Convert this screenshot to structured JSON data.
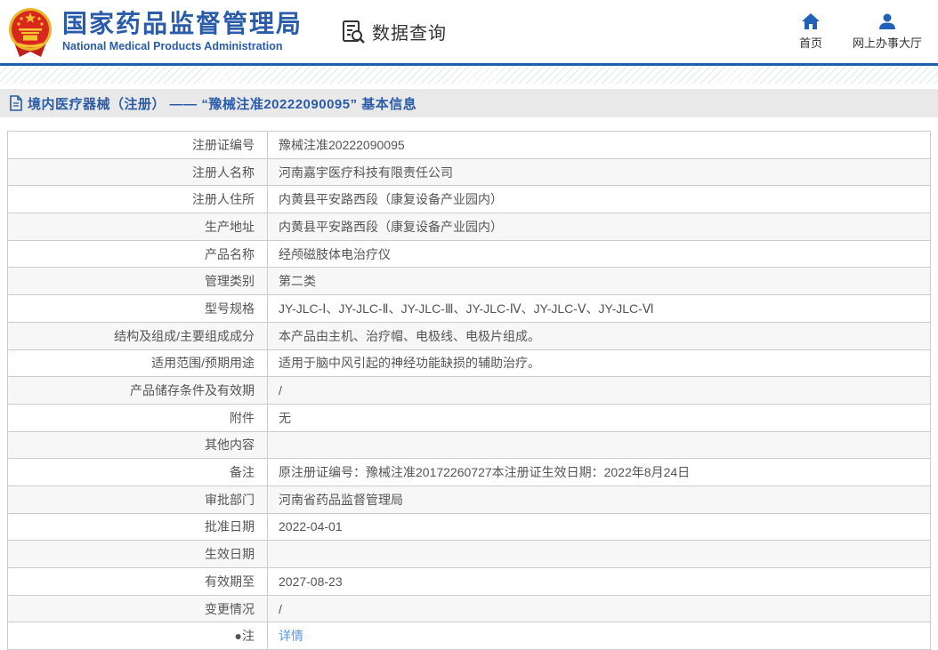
{
  "header": {
    "brand_title": "国家药品监督管理局",
    "brand_subtitle": "National Medical Products Administration",
    "data_query_label": "数据查询",
    "nav": {
      "home_label": "首页",
      "hall_label": "网上办事大厅"
    }
  },
  "title_bar": {
    "text": "境内医疗器械（注册） —— “豫械注准20222090095” 基本信息"
  },
  "table": {
    "rows": [
      {
        "label": "注册证编号",
        "value": "豫械注准20222090095"
      },
      {
        "label": "注册人名称",
        "value": "河南嘉宇医疗科技有限责任公司"
      },
      {
        "label": "注册人住所",
        "value": "内黄县平安路西段（康复设备产业园内）"
      },
      {
        "label": "生产地址",
        "value": "内黄县平安路西段（康复设备产业园内）"
      },
      {
        "label": "产品名称",
        "value": "经颅磁肢体电治疗仪"
      },
      {
        "label": "管理类别",
        "value": "第二类"
      },
      {
        "label": "型号规格",
        "value": "JY-JLC-Ⅰ、JY-JLC-Ⅱ、JY-JLC-Ⅲ、JY-JLC-Ⅳ、JY-JLC-Ⅴ、JY-JLC-Ⅵ"
      },
      {
        "label": "结构及组成/主要组成成分",
        "value": "本产品由主机、治疗帽、电极线、电极片组成。"
      },
      {
        "label": "适用范围/预期用途",
        "value": "适用于脑中风引起的神经功能缺损的辅助治疗。"
      },
      {
        "label": "产品储存条件及有效期",
        "value": "/"
      },
      {
        "label": "附件",
        "value": "无"
      },
      {
        "label": "其他内容",
        "value": ""
      },
      {
        "label": "备注",
        "value": "原注册证编号：豫械注准20172260727本注册证生效日期：2022年8月24日"
      },
      {
        "label": "审批部门",
        "value": "河南省药品监督管理局"
      },
      {
        "label": "批准日期",
        "value": "2022-04-01"
      },
      {
        "label": "生效日期",
        "value": ""
      },
      {
        "label": "有效期至",
        "value": "2027-08-23"
      },
      {
        "label": "变更情况",
        "value": "/"
      },
      {
        "label": "●注",
        "value": "详情",
        "link": true
      }
    ]
  },
  "colors": {
    "brand_blue": "#2a5caa",
    "nav_icon_blue": "#1f62b8",
    "divider_blue": "#1b60ae",
    "title_bar_bg": "#e9e9e9",
    "row_alt_bg": "#f7f7f7",
    "border": "#cccccc",
    "text": "#555555",
    "link_blue": "#5d96e0"
  }
}
